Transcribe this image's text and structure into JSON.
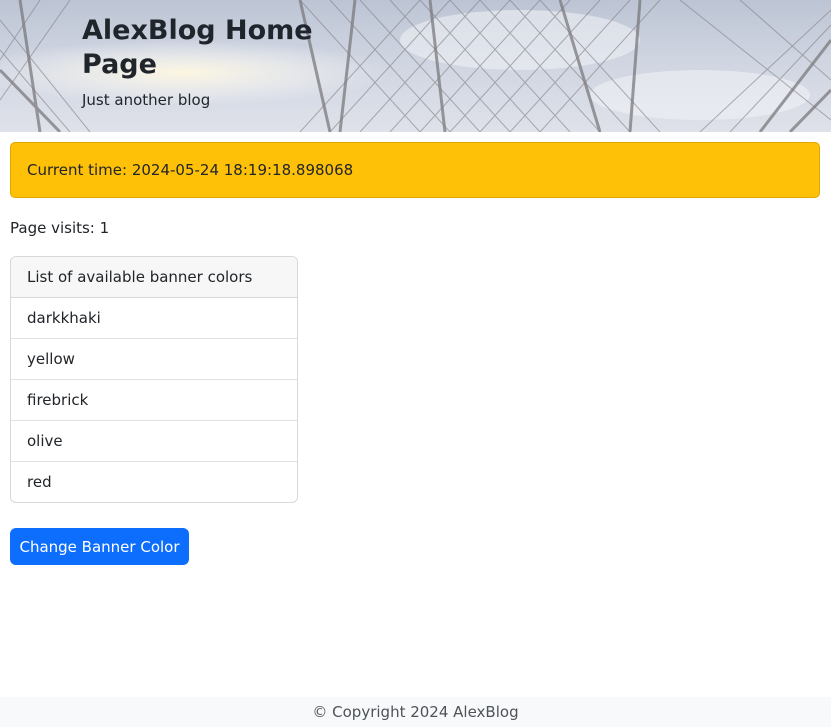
{
  "banner": {
    "title": "AlexBlog Home Page",
    "subtitle": "Just another blog"
  },
  "alert": {
    "text": "Current time: 2024-05-24 18:19:18.898068",
    "color": "#ffc107"
  },
  "visits": {
    "text": "Page visits: 1"
  },
  "colors_list": {
    "header": "List of available banner colors",
    "items": [
      "darkkhaki",
      "yellow",
      "firebrick",
      "olive",
      "red"
    ]
  },
  "change_button": {
    "label": "Change Banner Color",
    "color": "#0d6efd"
  },
  "footer": {
    "text": "© Copyright 2024 AlexBlog"
  }
}
